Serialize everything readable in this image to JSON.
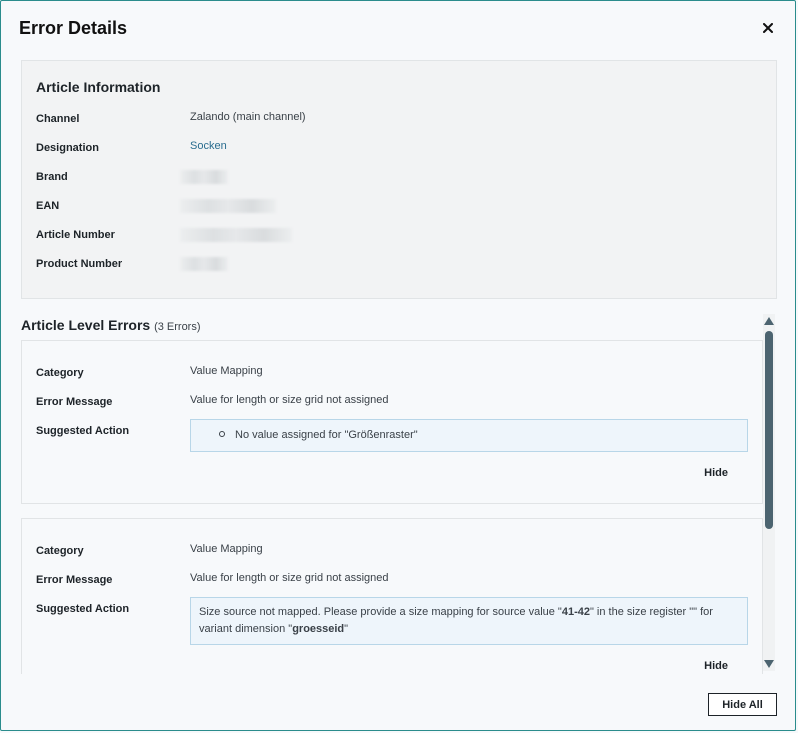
{
  "dialog": {
    "title": "Error Details",
    "close_icon": "close-icon"
  },
  "article_info": {
    "title": "Article Information",
    "rows": [
      {
        "key": "Channel",
        "value": "Zalando (main channel)"
      },
      {
        "key": "Designation",
        "value": "Socken"
      },
      {
        "key": "Brand",
        "value": ""
      },
      {
        "key": "EAN",
        "value": ""
      },
      {
        "key": "Article Number",
        "value": ""
      },
      {
        "key": "Product Number",
        "value": ""
      }
    ]
  },
  "errors": {
    "title": "Article Level Errors",
    "count_label": "(3 Errors)",
    "items": [
      {
        "category_key": "Category",
        "category": "Value Mapping",
        "message_key": "Error Message",
        "message": "Value for length or size grid not assigned",
        "action_key": "Suggested Action",
        "action_bullet": "No value assigned for \"Größenraster\"",
        "hide_label": "Hide"
      },
      {
        "category_key": "Category",
        "category": "Value Mapping",
        "message_key": "Error Message",
        "message": "Value for length or size grid not assigned",
        "action_key": "Suggested Action",
        "action_part1": "Size source not mapped. Please provide a size mapping for source value \"",
        "action_bold1": "41-42",
        "action_part2": "\" in the size register \"\" for",
        "action_part3": "variant dimension \"",
        "action_bold2": "groesseid",
        "action_part4": "\"",
        "hide_label": "Hide"
      }
    ]
  },
  "footer": {
    "hide_all_label": "Hide All"
  },
  "colors": {
    "accent_border": "#2a8c8c",
    "link": "#2a6d8f",
    "scroll_thumb": "#4c6470"
  }
}
